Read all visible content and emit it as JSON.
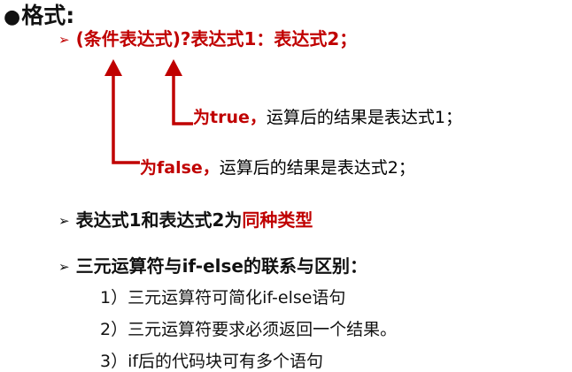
{
  "heading": {
    "bullet": "●",
    "text": "格式:"
  },
  "syntax": {
    "marker": "➢",
    "text": "(条件表达式)?表达式1：表达式2；"
  },
  "notes": {
    "true_keyword": "为true，",
    "true_rest": "运算后的结果是表达式1；",
    "false_keyword": "为false，",
    "false_rest": "运算后的结果是表达式2；"
  },
  "bullets": {
    "marker": "➢",
    "same_type_prefix": "表达式1和表达式2为",
    "same_type_highlight": "同种类型",
    "relation": "三元运算符与if-else的联系与区别："
  },
  "sub_items": [
    "1）三元运算符可简化if-else语句",
    "2）三元运算符要求必须返回一个结果。",
    "3）if后的代码块可有多个语句"
  ],
  "colors": {
    "accent_red": "#c00000",
    "text": "#111111"
  }
}
